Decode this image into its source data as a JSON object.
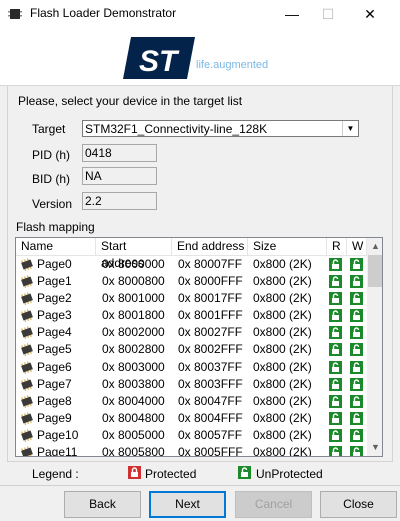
{
  "window": {
    "title": "Flash Loader Demonstrator",
    "min_glyph": "—",
    "max_glyph": "☐",
    "close_glyph": "✕"
  },
  "banner": {
    "logo_name": "st-logo",
    "tagline": "life.augmented",
    "brand_color": "#03234b",
    "tagline_color": "#7ab8e6"
  },
  "form": {
    "instruction": "Please, select your device in the target list",
    "target_label": "Target",
    "target_value": "STM32F1_Connectivity-line_128K",
    "pid_label": "PID  (h)",
    "pid_value": "0418",
    "bid_label": "BID  (h)",
    "bid_value": "NA",
    "version_label": "Version",
    "version_value": "2.2",
    "flash_mapping_label": "Flash mapping"
  },
  "table": {
    "columns": [
      "Name",
      "Start address",
      "End address",
      "Size",
      "R",
      "W"
    ],
    "rows": [
      {
        "name": "Page0",
        "start": "0x 8000000",
        "end": "0x 80007FF",
        "size": "0x800 (2K)"
      },
      {
        "name": "Page1",
        "start": "0x 8000800",
        "end": "0x 8000FFF",
        "size": "0x800 (2K)"
      },
      {
        "name": "Page2",
        "start": "0x 8001000",
        "end": "0x 80017FF",
        "size": "0x800 (2K)"
      },
      {
        "name": "Page3",
        "start": "0x 8001800",
        "end": "0x 8001FFF",
        "size": "0x800 (2K)"
      },
      {
        "name": "Page4",
        "start": "0x 8002000",
        "end": "0x 80027FF",
        "size": "0x800 (2K)"
      },
      {
        "name": "Page5",
        "start": "0x 8002800",
        "end": "0x 8002FFF",
        "size": "0x800 (2K)"
      },
      {
        "name": "Page6",
        "start": "0x 8003000",
        "end": "0x 80037FF",
        "size": "0x800 (2K)"
      },
      {
        "name": "Page7",
        "start": "0x 8003800",
        "end": "0x 8003FFF",
        "size": "0x800 (2K)"
      },
      {
        "name": "Page8",
        "start": "0x 8004000",
        "end": "0x 80047FF",
        "size": "0x800 (2K)"
      },
      {
        "name": "Page9",
        "start": "0x 8004800",
        "end": "0x 8004FFF",
        "size": "0x800 (2K)"
      },
      {
        "name": "Page10",
        "start": "0x 8005000",
        "end": "0x 80057FF",
        "size": "0x800 (2K)"
      },
      {
        "name": "Page11",
        "start": "0x 8005800",
        "end": "0x 8005FFF",
        "size": "0x800 (2K)"
      }
    ],
    "lock_state": "unprotected",
    "lock_color": "#1a8a2a"
  },
  "legend": {
    "label": "Legend :",
    "protected": "Protected",
    "unprotected": "UnProtected",
    "protected_color": "#d03030",
    "unprotected_color": "#1a8a2a"
  },
  "buttons": {
    "back": "Back",
    "next": "Next",
    "cancel": "Cancel",
    "close": "Close"
  }
}
